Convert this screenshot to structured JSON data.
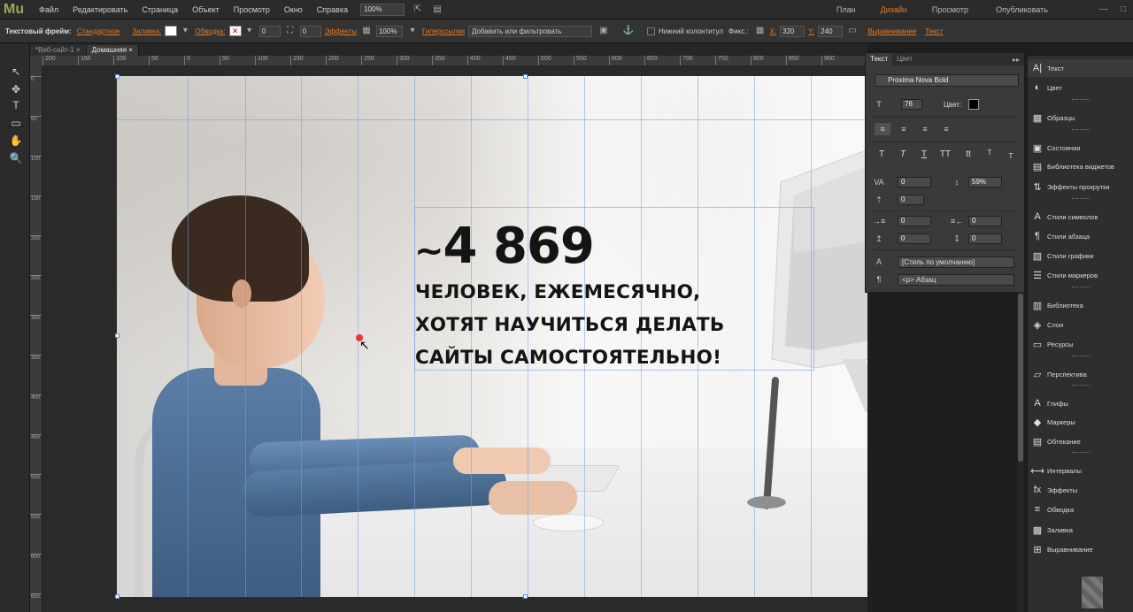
{
  "app": {
    "logo": "Mu",
    "menu": [
      "Файл",
      "Редактировать",
      "Страница",
      "Объект",
      "Просмотр",
      "Окно",
      "Справка"
    ],
    "zoom": "100%",
    "modes": [
      "План",
      "Дизайн",
      "Просмотр"
    ],
    "active_mode": "Дизайн",
    "publish": "Опубликовать"
  },
  "controlbar": {
    "frame_label": "Текстовый фрейм:",
    "style": "Стандартное",
    "fill_label": "Заливка:",
    "stroke_label": "Обводка:",
    "stroke_width": "0",
    "padding": "0",
    "effects_label": "Эффекты",
    "opacity": "100%",
    "hyperlinks_label": "Гиперссылки",
    "hyperlinks_placeholder": "Добавить или фильтровать",
    "footer_label": "Нижний колонтитул",
    "fixed_label": "Фикс.:",
    "x_label": "X:",
    "x_value": "320",
    "y_label": "Y:",
    "y_value": "240",
    "align_label": "Выравнивание",
    "text_label": "Текст"
  },
  "doctabs": [
    "*Веб-сайт-1",
    "Домашняя"
  ],
  "ruler_h": [
    "200",
    "150",
    "100",
    "50",
    "0",
    "50",
    "100",
    "150",
    "200",
    "250",
    "300",
    "350",
    "400",
    "450",
    "500",
    "550",
    "600",
    "650",
    "700",
    "750",
    "800",
    "850",
    "900"
  ],
  "ruler_v": [
    "0",
    "50",
    "100",
    "150",
    "200",
    "250",
    "300",
    "350",
    "400",
    "450",
    "500",
    "550",
    "600",
    "650"
  ],
  "canvas": {
    "number": "4 869",
    "tilde": "~",
    "line1": "ЧЕЛОВЕК, ЕЖЕМЕСЯЧНО,",
    "line2": "ХОТЯТ НАУЧИТЬСЯ ДЕЛАТЬ",
    "line3": "САЙТЫ САМОСТОЯТЕЛЬНО!"
  },
  "text_panel": {
    "tabs": [
      "Текст",
      "Цвет"
    ],
    "font": "Proxima Nova Bold",
    "size": "76",
    "color_label": "Цвет:",
    "tracking": "0",
    "leading": "59%",
    "indent_a": "0",
    "indent_b": "0",
    "space_a": "0",
    "space_b": "0",
    "space_c": "0",
    "space_d": "0",
    "char_style": "[Стиль по умолчанию]",
    "para_style": "<p> Абзац",
    "case_buttons": [
      "T",
      "T",
      "T",
      "TT",
      "tt",
      "T",
      "T"
    ]
  },
  "dock": {
    "items": [
      {
        "label": "Текст",
        "icon": "text-icon",
        "glyph": "A|"
      },
      {
        "label": "Цвет",
        "icon": "color-icon",
        "glyph": "◐"
      },
      {
        "label": "Образцы",
        "icon": "swatches-icon",
        "glyph": "▦"
      },
      {
        "label": "Состояния",
        "icon": "states-icon",
        "glyph": "▣"
      },
      {
        "label": "Библиотека виджетов",
        "icon": "widget-library-icon",
        "glyph": "▤"
      },
      {
        "label": "Эффекты прокрутки",
        "icon": "scroll-effects-icon",
        "glyph": "⇅"
      },
      {
        "label": "Стили символов",
        "icon": "char-styles-icon",
        "glyph": "A"
      },
      {
        "label": "Стили абзаца",
        "icon": "para-styles-icon",
        "glyph": "¶"
      },
      {
        "label": "Стили графики",
        "icon": "graphic-styles-icon",
        "glyph": "▧"
      },
      {
        "label": "Стили маркеров",
        "icon": "bullet-styles-icon",
        "glyph": "☰"
      },
      {
        "label": "Библиотека",
        "icon": "library-icon",
        "glyph": "▥"
      },
      {
        "label": "Слои",
        "icon": "layers-icon",
        "glyph": "◈"
      },
      {
        "label": "Ресурсы",
        "icon": "assets-icon",
        "glyph": "▭"
      },
      {
        "label": "Перспектива",
        "icon": "perspective-icon",
        "glyph": "▱"
      },
      {
        "label": "Глифы",
        "icon": "glyphs-icon",
        "glyph": "A"
      },
      {
        "label": "Маркеры",
        "icon": "markers-icon",
        "glyph": "◆"
      },
      {
        "label": "Обтекание",
        "icon": "wrap-icon",
        "glyph": "▤"
      },
      {
        "label": "Интервалы",
        "icon": "spacing-icon",
        "glyph": "⟷"
      },
      {
        "label": "Эффекты",
        "icon": "fx-icon",
        "glyph": "fx"
      },
      {
        "label": "Обводка",
        "icon": "stroke-icon",
        "glyph": "≡"
      },
      {
        "label": "Заливка",
        "icon": "fill-icon",
        "glyph": "▩"
      },
      {
        "label": "Выравнивание",
        "icon": "align-icon",
        "glyph": "⊞"
      }
    ]
  },
  "colors": {
    "accent": "#e8771e",
    "guide": "#78a0e6",
    "panel_bg": "#3a3a3a"
  }
}
